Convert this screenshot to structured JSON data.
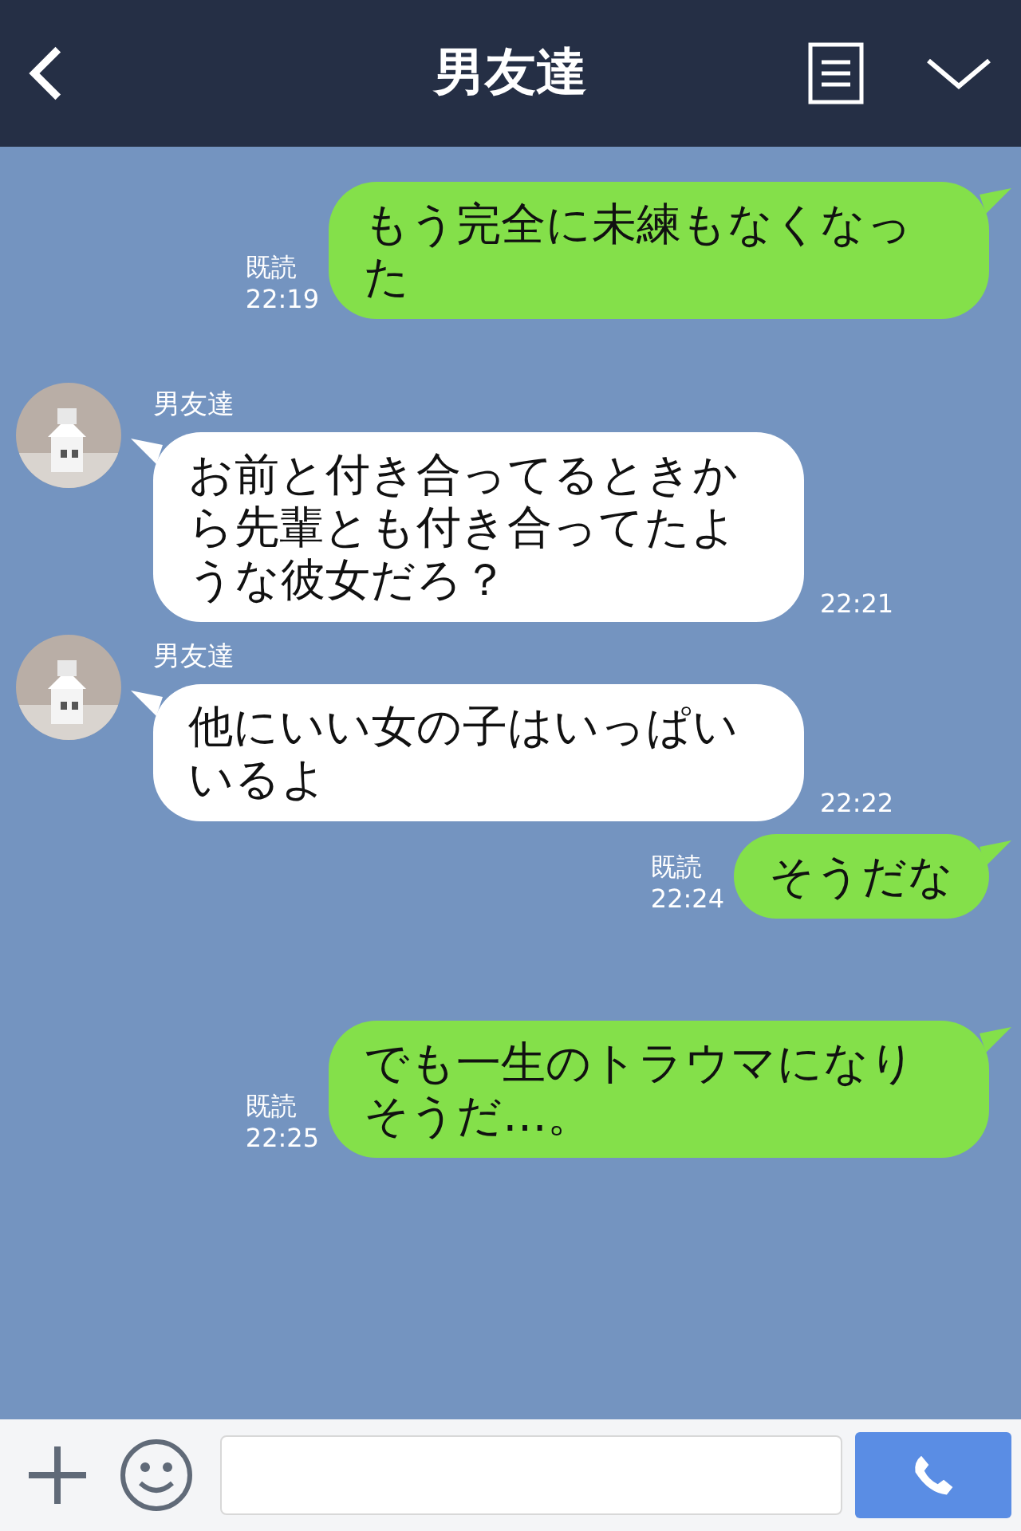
{
  "header": {
    "title": "男友達"
  },
  "messages": [
    {
      "kind": "sent",
      "read": "既読",
      "time": "22:19",
      "text": "もう完全に未練もなくなった"
    },
    {
      "kind": "received",
      "sender": "男友達",
      "time": "22:21",
      "text": "お前と付き合ってるときから先輩とも付き合ってたような彼女だろ？"
    },
    {
      "kind": "received",
      "sender": "男友達",
      "time": "22:22",
      "text": "他にいい女の子はいっぱいいるよ"
    },
    {
      "kind": "sent",
      "read": "既読",
      "time": "22:24",
      "text": "そうだな"
    },
    {
      "kind": "sent",
      "read": "既読",
      "time": "22:25",
      "text": "でも一生のトラウマになりそうだ…。"
    }
  ]
}
